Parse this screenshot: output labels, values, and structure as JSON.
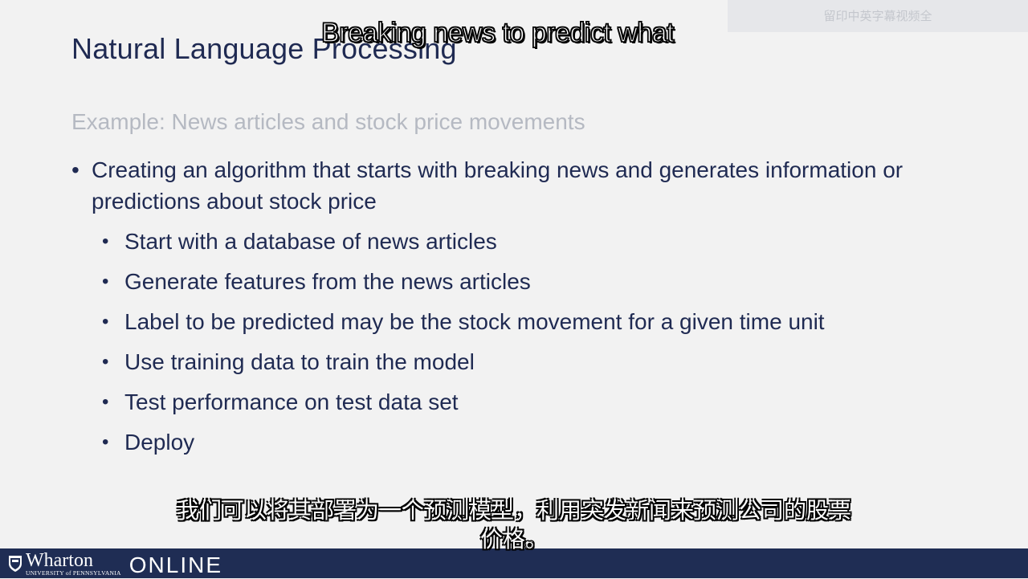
{
  "slide": {
    "title": "Natural Language Processing",
    "subtitle": "Example: News articles and stock price movements",
    "bullet_main": "Creating an algorithm that starts with breaking news and generates information or predictions about stock price",
    "sub_bullets": [
      "Start with a database of news articles",
      "Generate features from the news articles",
      "Label to be predicted may be the stock movement for a given time unit",
      "Use training data to train the model",
      "Test performance on test data set",
      "Deploy"
    ]
  },
  "captions": {
    "english": "Breaking news to predict what",
    "chinese_line1": "我们可以将其部署为一个预测模型，利用突发新闻来预测公司的股票",
    "chinese_line2": "价格。"
  },
  "watermark": {
    "text": "留印中英字幕视频全"
  },
  "footer": {
    "logo_main": "Wharton",
    "logo_sub": "UNIVERSITY of PENNSYLVANIA",
    "online": "ONLINE",
    "color": "#1f2d54"
  }
}
